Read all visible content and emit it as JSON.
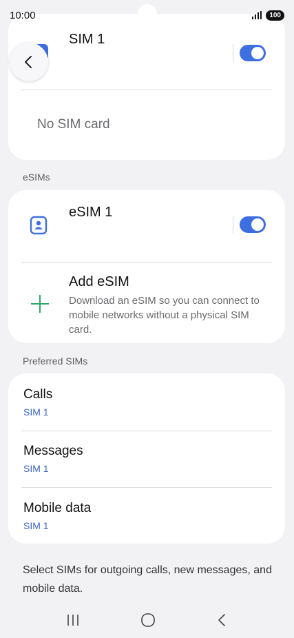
{
  "status_bar": {
    "time": "10:00",
    "battery": "100"
  },
  "sim_card": {
    "title": "SIM 1",
    "toggle_on": true,
    "no_sim_text": "No SIM card"
  },
  "esims": {
    "section_label": "eSIMs",
    "esim1": {
      "title": "eSIM 1",
      "toggle_on": true
    },
    "add_esim": {
      "title": "Add eSIM",
      "description": "Download an eSIM so you can connect to mobile networks without a physical SIM card."
    }
  },
  "preferred": {
    "section_label": "Preferred SIMs",
    "items": [
      {
        "title": "Calls",
        "value": "SIM 1"
      },
      {
        "title": "Messages",
        "value": "SIM 1"
      },
      {
        "title": "Mobile data",
        "value": "SIM 1"
      }
    ]
  },
  "footer_note": "Select SIMs for outgoing calls, new messages, and mobile data.",
  "colors": {
    "accent": "#3e6fe0",
    "link": "#3a66c8",
    "add_icon": "#2fa46a",
    "background": "#f2f2f4"
  },
  "icons": {
    "back": "chevron-left-icon",
    "esim": "sim-card-icon",
    "add": "plus-icon"
  }
}
